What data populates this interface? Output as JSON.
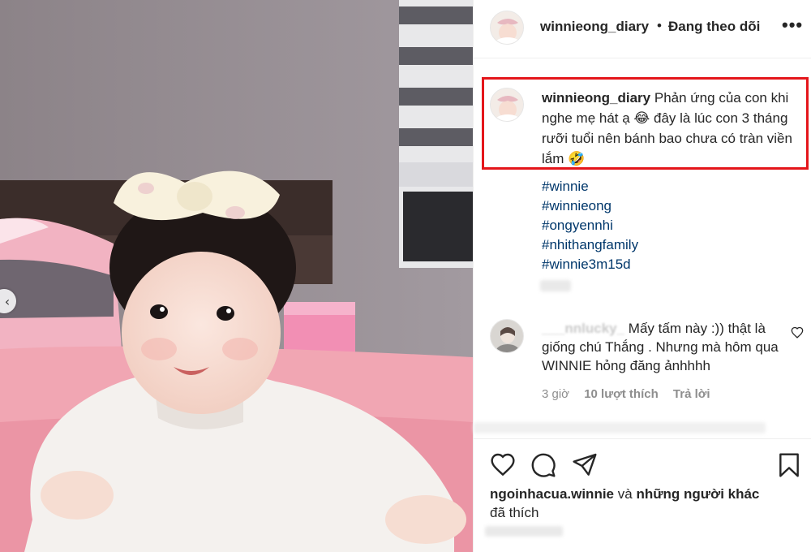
{
  "post": {
    "username": "winnieong_diary",
    "follow_status": "Đang theo dõi",
    "more": "•••",
    "dot": "•"
  },
  "caption": {
    "username": "winnieong_diary",
    "text": "Phản ứng của con khi nghe mẹ hát ạ 😂 đây là lúc con 3 tháng rưỡi tuổi nên bánh bao chưa có tràn viền lắm 🤣",
    "hashtags": [
      "#winnie",
      "#winnieong",
      "#ongyennhi",
      "#nhithangfamily",
      "#winnie3m15d"
    ],
    "highlight_color": "#e4161b"
  },
  "comment": {
    "username": "___nnlucky_",
    "text": "Mấy tấm này :)) thật là giống chú Thắng . Nhưng mà hôm qua WINNIE hỏng đăng ảnhhhh",
    "time": "3 giờ",
    "likes": "10 lượt thích",
    "reply": "Trả lời"
  },
  "likes": {
    "user": "ngoinhacua.winnie",
    "connector": "và",
    "others": "những người khác",
    "suffix": "đã thích"
  },
  "photo": {
    "prev_icon": "‹"
  },
  "colors": {
    "hashtag": "#00376b",
    "muted": "#8e8e8e",
    "divider": "#efefef"
  }
}
